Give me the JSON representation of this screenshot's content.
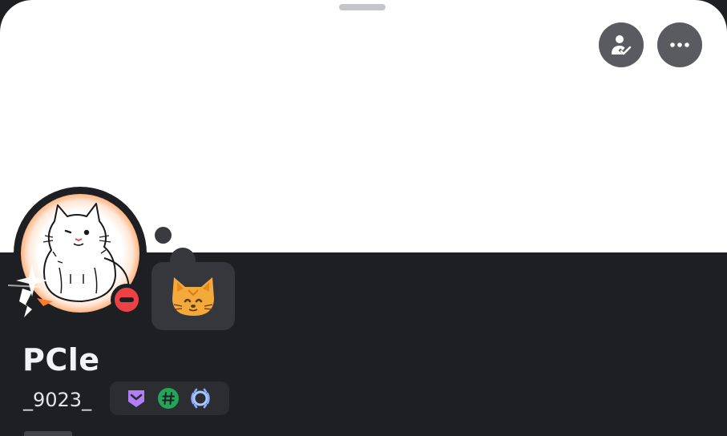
{
  "profile": {
    "display_name": "PCle",
    "username": "_9023_",
    "status": "dnd",
    "custom_status_emoji": "cat-face-emoji"
  },
  "actions": {
    "friend_icon": "person-check-icon",
    "more_icon": "more-dots-icon"
  },
  "badges": [
    {
      "icon": "nitro-badge-icon",
      "color": "#b17ef7"
    },
    {
      "icon": "hashtag-badge-icon",
      "color": "#23a55a"
    },
    {
      "icon": "quest-laurel-badge-icon",
      "color": "#a6c8ff"
    }
  ],
  "colors": {
    "banner": "#ffffff",
    "panel": "#1e1f22",
    "dnd": "#ed4245",
    "accent_orange": "#ff6a14"
  }
}
